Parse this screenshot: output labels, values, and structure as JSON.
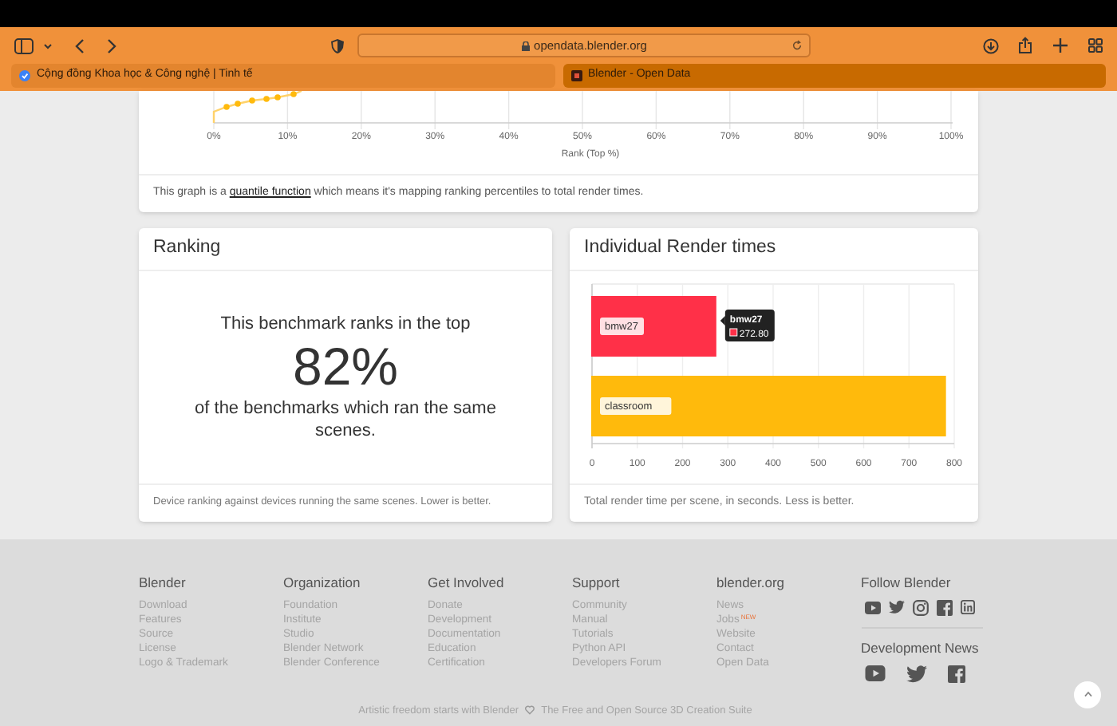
{
  "browser": {
    "url": "opendata.blender.org",
    "tabs": [
      {
        "title": "Cộng đồng Khoa học & Công nghệ | Tinh tế",
        "selected": false
      },
      {
        "title": "Blender - Open Data",
        "selected": true
      }
    ]
  },
  "quantile_card": {
    "x_tick_labels": [
      "0%",
      "10%",
      "20%",
      "30%",
      "40%",
      "50%",
      "60%",
      "70%",
      "80%",
      "90%",
      "100%"
    ],
    "xlabel": "Rank (Top %)",
    "note_before": "This graph is a ",
    "note_link": "quantile function",
    "note_after": " which means it's mapping ranking percentiles to total render times."
  },
  "ranking_card": {
    "title": "Ranking",
    "lead": "This benchmark ranks in the top",
    "value": "82%",
    "trail": "of the benchmarks which ran the same scenes.",
    "footnote": "Device ranking against devices running the same scenes. Lower is better."
  },
  "render_card": {
    "title": "Individual Render times",
    "chart_data": {
      "type": "bar",
      "orientation": "horizontal",
      "grid": true,
      "series": [
        {
          "name": "bmw27",
          "color": "#ff3048",
          "values": [
            272.8
          ]
        },
        {
          "name": "classroom",
          "color": "#ffba0c",
          "values": [
            780
          ]
        }
      ],
      "xlim": [
        0,
        800
      ],
      "xticks": [
        0,
        100,
        200,
        300,
        400,
        500,
        600,
        700,
        800
      ]
    },
    "tooltip": {
      "title": "bmw27",
      "value": "272.80"
    },
    "footnote": "Total render time per scene, in seconds. Less is better."
  },
  "footer": {
    "columns": [
      {
        "title": "Blender",
        "links": [
          {
            "label": "Download"
          },
          {
            "label": "Features"
          },
          {
            "label": "Source"
          },
          {
            "label": "License"
          },
          {
            "label": "Logo & Trademark"
          }
        ]
      },
      {
        "title": "Organization",
        "links": [
          {
            "label": "Foundation"
          },
          {
            "label": "Institute"
          },
          {
            "label": "Studio"
          },
          {
            "label": "Blender Network"
          },
          {
            "label": "Blender Conference"
          }
        ]
      },
      {
        "title": "Get Involved",
        "links": [
          {
            "label": "Donate"
          },
          {
            "label": "Development"
          },
          {
            "label": "Documentation"
          },
          {
            "label": "Education"
          },
          {
            "label": "Certification"
          }
        ]
      },
      {
        "title": "Support",
        "links": [
          {
            "label": "Community"
          },
          {
            "label": "Manual"
          },
          {
            "label": "Tutorials"
          },
          {
            "label": "Python API"
          },
          {
            "label": "Developers Forum"
          }
        ]
      },
      {
        "title": "blender.org",
        "links": [
          {
            "label": "News"
          },
          {
            "label": "Jobs",
            "badge": "NEW"
          },
          {
            "label": "Website"
          },
          {
            "label": "Contact"
          },
          {
            "label": "Open Data"
          }
        ]
      }
    ],
    "follow_title": "Follow Blender",
    "dev_news_title": "Development News",
    "tagline": [
      "Artistic freedom starts with Blender",
      "The Free and Open Source 3D Creation Suite"
    ]
  }
}
